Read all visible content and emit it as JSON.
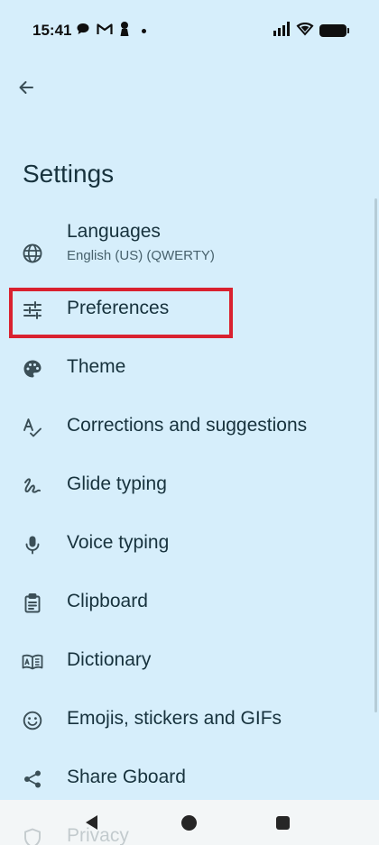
{
  "status_bar": {
    "time": "15:41",
    "left_icons": [
      "chat-bubble-icon",
      "gmail-icon",
      "keyhole-icon",
      "dot-icon"
    ],
    "right_icons": [
      "signal-icon",
      "wifi-icon",
      "battery-icon"
    ]
  },
  "header": {
    "back_icon": "arrow-left-icon",
    "title": "Settings"
  },
  "settings": {
    "items": [
      {
        "label": "Languages",
        "sublabel": "English (US) (QWERTY)",
        "icon": "globe-icon"
      },
      {
        "label": "Preferences",
        "icon": "tune-sliders-icon",
        "highlighted": true
      },
      {
        "label": "Theme",
        "icon": "palette-icon"
      },
      {
        "label": "Corrections and suggestions",
        "icon": "spellcheck-icon"
      },
      {
        "label": "Glide typing",
        "icon": "gesture-icon"
      },
      {
        "label": "Voice typing",
        "icon": "mic-icon"
      },
      {
        "label": "Clipboard",
        "icon": "clipboard-icon"
      },
      {
        "label": "Dictionary",
        "icon": "book-icon"
      },
      {
        "label": "Emojis, stickers and GIFs",
        "icon": "smiley-icon"
      },
      {
        "label": "Share Gboard",
        "icon": "share-icon"
      },
      {
        "label": "Privacy",
        "icon": "shield-icon"
      }
    ]
  },
  "highlight_color": "#d9212f",
  "nav_bar": {
    "buttons": [
      "back-triangle-icon",
      "home-circle-icon",
      "recents-square-icon"
    ]
  }
}
